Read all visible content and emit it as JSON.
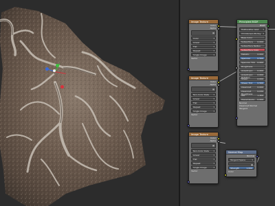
{
  "viewport": {
    "label": "3D Viewport"
  },
  "gizmo": {
    "colors": {
      "x": "#d6323c",
      "y": "#3fbf3f",
      "z": "#3a6ad8"
    }
  },
  "nodes": {
    "image_texture_1": {
      "title": "Image Texture",
      "outputs": [
        "Color",
        "Alpha"
      ],
      "dropdowns": [
        "Color",
        "Linear",
        "Flat",
        "Repeat",
        "Single Image"
      ],
      "footer": "Vector"
    },
    "image_texture_2": {
      "title": "Image Texture",
      "outputs": [
        "Color",
        "Alpha"
      ],
      "dropdowns": [
        "Non-Color Data",
        "Linear",
        "Flat",
        "Repeat",
        "Single Image"
      ],
      "footer": "Vector"
    },
    "image_texture_3": {
      "title": "Image Texture",
      "outputs": [
        "Color",
        "Alpha"
      ],
      "dropdowns": [
        "Non-Color Data",
        "Linear",
        "Flat",
        "Repeat",
        "Single Image"
      ],
      "footer": "Vector"
    },
    "principled": {
      "title": "Principled BSDF",
      "output": "BSDF",
      "dropdowns": [
        "Multiscatter GGX",
        "Christensen-Burley"
      ],
      "fields": [
        {
          "label": "Base Color",
          "value": ""
        },
        {
          "label": "Subsurface",
          "value": "0.000"
        },
        {
          "label": "Subsurface Radius",
          "value": ""
        },
        {
          "label": "Subsurface Color",
          "value": ""
        },
        {
          "label": "Metallic",
          "value": "0.000"
        },
        {
          "label": "Specular",
          "value": "0.500"
        },
        {
          "label": "Specular Tint",
          "value": "0.000"
        },
        {
          "label": "Roughness",
          "value": ""
        },
        {
          "label": "Anisotropic",
          "value": "0.000"
        },
        {
          "label": "Anisotropic Rotation",
          "value": "0.000"
        },
        {
          "label": "Sheen",
          "value": "0.000"
        },
        {
          "label": "Sheen Tint",
          "value": "0.500"
        },
        {
          "label": "Clearcoat",
          "value": "0.000"
        },
        {
          "label": "Clearcoat Roughness",
          "value": "0.030"
        },
        {
          "label": "IOR",
          "value": "1.450"
        },
        {
          "label": "Transmission",
          "value": "0.000"
        },
        {
          "label": "Normal",
          "value": ""
        },
        {
          "label": "Clearcoat Normal",
          "value": ""
        },
        {
          "label": "Tangent",
          "value": ""
        }
      ]
    },
    "normal_map": {
      "title": "Normal Map",
      "output": "Normal",
      "dropdown": "Tangent Space",
      "field_label": "Strength",
      "field_value": "1.000",
      "footer": "Color"
    }
  }
}
